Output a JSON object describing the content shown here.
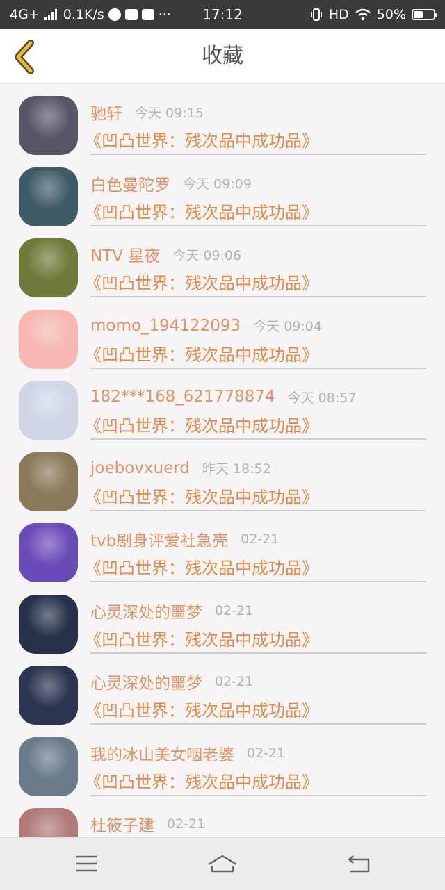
{
  "status_bar": {
    "network": "4G+",
    "speed": "0.1K/s",
    "dots": "···",
    "time": "17:12",
    "hd": "HD",
    "battery_text": "50%",
    "battery_level": 0.5
  },
  "header": {
    "title": "收藏"
  },
  "items": [
    {
      "name": "驰轩",
      "time": "今天 09:15",
      "work": "《凹凸世界：残次品中成功品》"
    },
    {
      "name": "白色曼陀罗",
      "time": "今天 09:09",
      "work": "《凹凸世界：残次品中成功品》"
    },
    {
      "name": "NTV 星夜",
      "time": "今天 09:06",
      "work": "《凹凸世界：残次品中成功品》"
    },
    {
      "name": "momo_194122093",
      "time": "今天 09:04",
      "work": "《凹凸世界：残次品中成功品》"
    },
    {
      "name": "182***168_621778874",
      "time": "今天 08:57",
      "work": "《凹凸世界：残次品中成功品》"
    },
    {
      "name": "joebovxuerd",
      "time": "昨天 18:52",
      "work": "《凹凸世界：残次品中成功品》"
    },
    {
      "name": "tvb剧身评爱社急壳",
      "time": "02-21",
      "work": "《凹凸世界：残次品中成功品》"
    },
    {
      "name": "心灵深处的噩梦",
      "time": "02-21",
      "work": "《凹凸世界：残次品中成功品》"
    },
    {
      "name": "心灵深处的噩梦",
      "time": "02-21",
      "work": "《凹凸世界：残次品中成功品》"
    },
    {
      "name": "我的冰山美女咽老婆",
      "time": "02-21",
      "work": "《凹凸世界：残次品中成功品》"
    },
    {
      "name": "杜筱子建",
      "time": "02-21",
      "work": ""
    }
  ],
  "avatar_colors": [
    "#5a5566",
    "#3d5a66",
    "#6e7a3a",
    "#f6b8b0",
    "#cfd6e6",
    "#8a7a5a",
    "#6b4bb8",
    "#27324a",
    "#2b3450",
    "#6a7a8a",
    "#b07a7a"
  ],
  "nav": {
    "menu_icon": "menu-icon",
    "home_icon": "home-icon",
    "back_icon": "return-icon"
  },
  "colors": {
    "accent": "#e58a4d",
    "name": "#e09368",
    "time": "#b3b3b3",
    "back_arrow": "#e8b740"
  }
}
